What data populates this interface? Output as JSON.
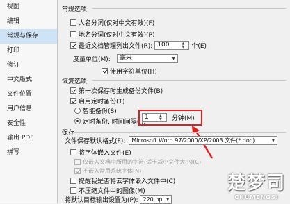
{
  "sidebar": {
    "items": [
      {
        "label": "视图"
      },
      {
        "label": "编辑"
      },
      {
        "label": "常规与保存"
      },
      {
        "label": "打印"
      },
      {
        "label": "修订"
      },
      {
        "label": "中文版式"
      },
      {
        "label": "文件位置"
      },
      {
        "label": "用户信息"
      },
      {
        "label": "安全性"
      },
      {
        "label": "输出 PDF"
      },
      {
        "label": "拼写"
      }
    ],
    "selected_index": 2
  },
  "general": {
    "title": "常规选项",
    "person_name": {
      "label": "人名分词(仅对中文有效)(F)",
      "checked": false
    },
    "place_name": {
      "label": "地名分词(仅对中文有效)(P)",
      "checked": false
    },
    "recent_docs": {
      "label": "最近文档管理列出文件(R):",
      "checked": true,
      "value": "100",
      "unit": "个(E)"
    },
    "unit_label": "度量单位(M):",
    "unit_value": "毫米",
    "char_unit": {
      "label": "使用字符单位(H)",
      "checked": true
    }
  },
  "recovery": {
    "title": "恢复选项",
    "first_save_backup": {
      "label": "第一次保存时生成备份文件(B)",
      "checked": true
    },
    "timed_backup": {
      "label": "启用定时备份(T)",
      "checked": true
    },
    "smart_backup": {
      "label": "智能备份(S)",
      "selected": false
    },
    "interval_backup": {
      "label": "定时备份, 时间间隔(I):",
      "selected": true,
      "value": "1",
      "unit": "分钟(M)"
    }
  },
  "save": {
    "title": "保存",
    "format_label": "文件保存默认格式(F):",
    "format_value": "Microsoft Word 97/2000/XP/2003 文件(*.doc)",
    "embed_fonts": {
      "label": "将字体嵌入文件(E)",
      "checked": false
    },
    "embed_used_chars": {
      "label": "仅嵌入文档中所用的字符(适于减小文件大小)(C)",
      "checked": false
    },
    "no_common_fonts": {
      "label": "不嵌入常用系统字体(N)",
      "checked": true
    },
    "remind_fonts": {
      "label": "提醒我是否将云字体嵌入文件中(C)",
      "checked": false
    },
    "no_compress_images": {
      "label": "不压缩文件中的图像(M)",
      "checked": false
    },
    "resolution_label": "将默认目标输出设置为(P):",
    "resolution_value": "220 ppi"
  },
  "watermark": {
    "logo": "楚梦司",
    "sub": "CHUMENGSI"
  },
  "colors": {
    "highlight": "#e02020",
    "selection": "#cfe3f7"
  }
}
